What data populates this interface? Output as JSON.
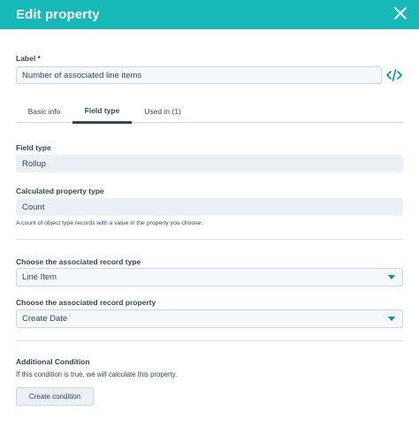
{
  "header": {
    "title": "Edit property",
    "color": "#16b8b8"
  },
  "label_section": {
    "label": "Label *",
    "value": "Number of associated line items",
    "code_icon": "code-icon"
  },
  "tabs": [
    {
      "label": "Basic info",
      "active": false
    },
    {
      "label": "Field type",
      "active": true
    },
    {
      "label": "Used in (1)",
      "active": false
    }
  ],
  "field_type": {
    "label": "Field type",
    "value": "Rollup"
  },
  "calculated_property_type": {
    "label": "Calculated property type",
    "value": "Count",
    "helper": "A count of object type records with a value in the property you choose."
  },
  "associated_record_type": {
    "label": "Choose the associated record type",
    "value": "Line Item"
  },
  "associated_record_property": {
    "label": "Choose the associated record property",
    "value": "Create Date"
  },
  "additional_condition": {
    "label": "Additional Condition",
    "description": "If this condition is true, we will calculate this property.",
    "button_label": "Create condition"
  },
  "colors": {
    "accent": "#0091ae",
    "text": "#33475b",
    "field_bg": "#eaf0f6"
  }
}
